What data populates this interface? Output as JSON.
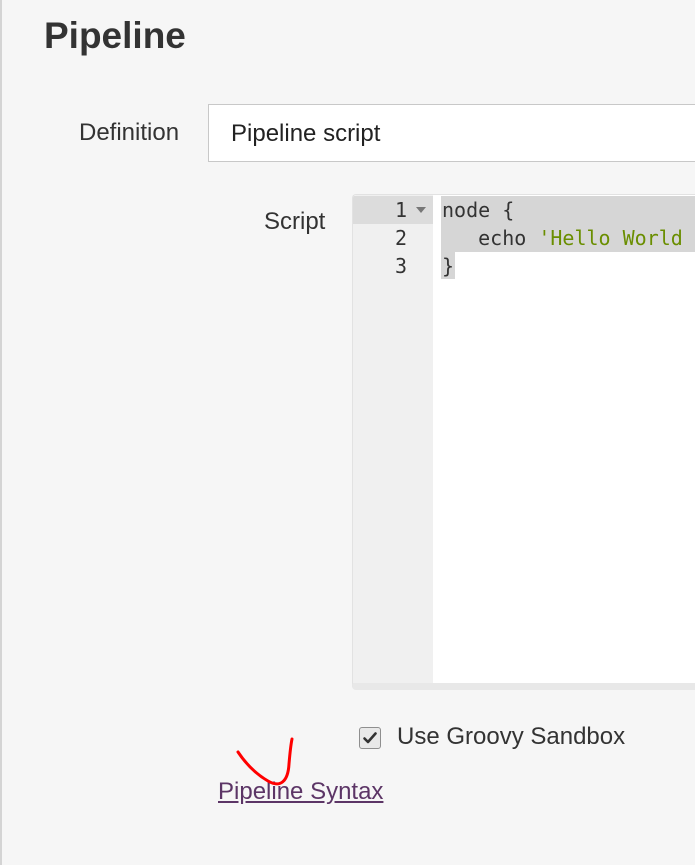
{
  "section": {
    "title": "Pipeline"
  },
  "definition": {
    "label": "Definition",
    "selected": "Pipeline script"
  },
  "script": {
    "label": "Script",
    "line_numbers": [
      "1",
      "2",
      "3"
    ],
    "lines": {
      "line1": "node {",
      "line2_prefix": "   echo ",
      "line2_string": "'Hello World",
      "line3": "}"
    }
  },
  "sandbox": {
    "label": "Use Groovy Sandbox",
    "checked": true
  },
  "links": {
    "pipeline_syntax": "Pipeline Syntax"
  },
  "colors": {
    "link": "#5c3566",
    "string_literal": "#6a8e00",
    "annotation": "#ff0000"
  }
}
